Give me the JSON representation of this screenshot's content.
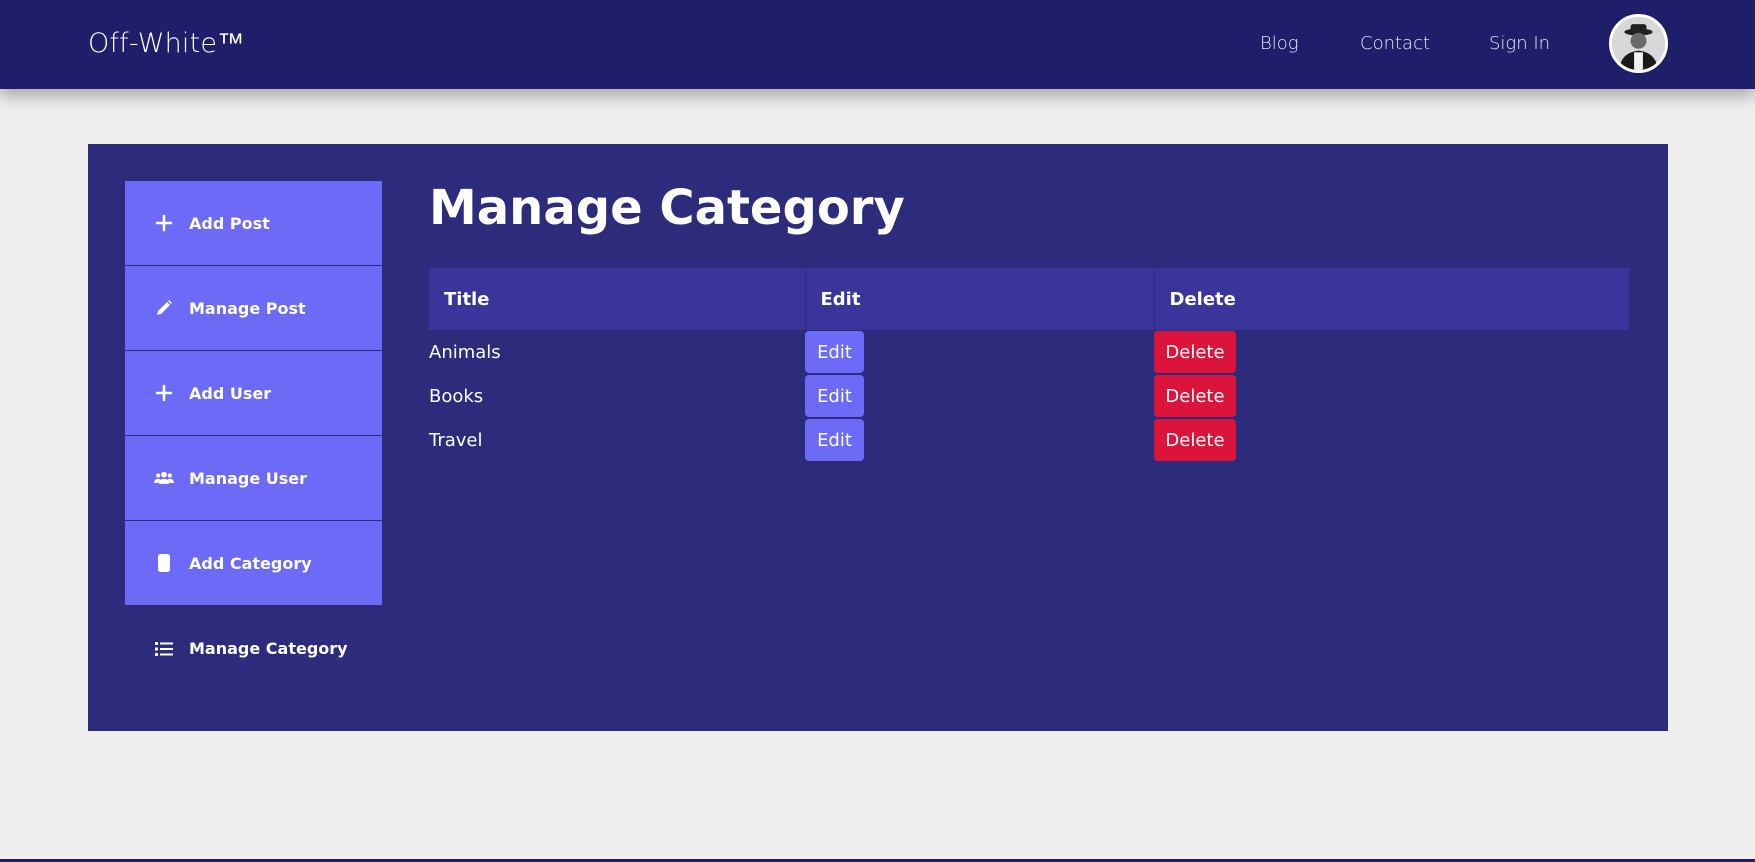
{
  "nav": {
    "brand": "Off-White™",
    "links": [
      "Blog",
      "Contact",
      "Sign In"
    ],
    "avatar_icon": "user-avatar"
  },
  "sidebar": {
    "items": [
      {
        "label": "Add Post",
        "icon": "plus-icon"
      },
      {
        "label": "Manage Post",
        "icon": "pencil-icon"
      },
      {
        "label": "Add User",
        "icon": "plus-icon"
      },
      {
        "label": "Manage User",
        "icon": "users-icon"
      },
      {
        "label": "Add Category",
        "icon": "mobile-icon"
      },
      {
        "label": "Manage Category",
        "icon": "list-icon"
      }
    ]
  },
  "main": {
    "title": "Manage Category",
    "table": {
      "headers": [
        "Title",
        "Edit",
        "Delete"
      ],
      "rows": [
        {
          "title": "Animals",
          "edit": "Edit",
          "delete": "Delete"
        },
        {
          "title": "Books",
          "edit": "Edit",
          "delete": "Delete"
        },
        {
          "title": "Travel",
          "edit": "Edit",
          "delete": "Delete"
        }
      ]
    }
  },
  "colors": {
    "navbar": "#1e1e6a",
    "panel": "#2d2b7c",
    "accent": "#6c6af7",
    "danger": "#dc143c",
    "page_bg": "#efefef"
  }
}
